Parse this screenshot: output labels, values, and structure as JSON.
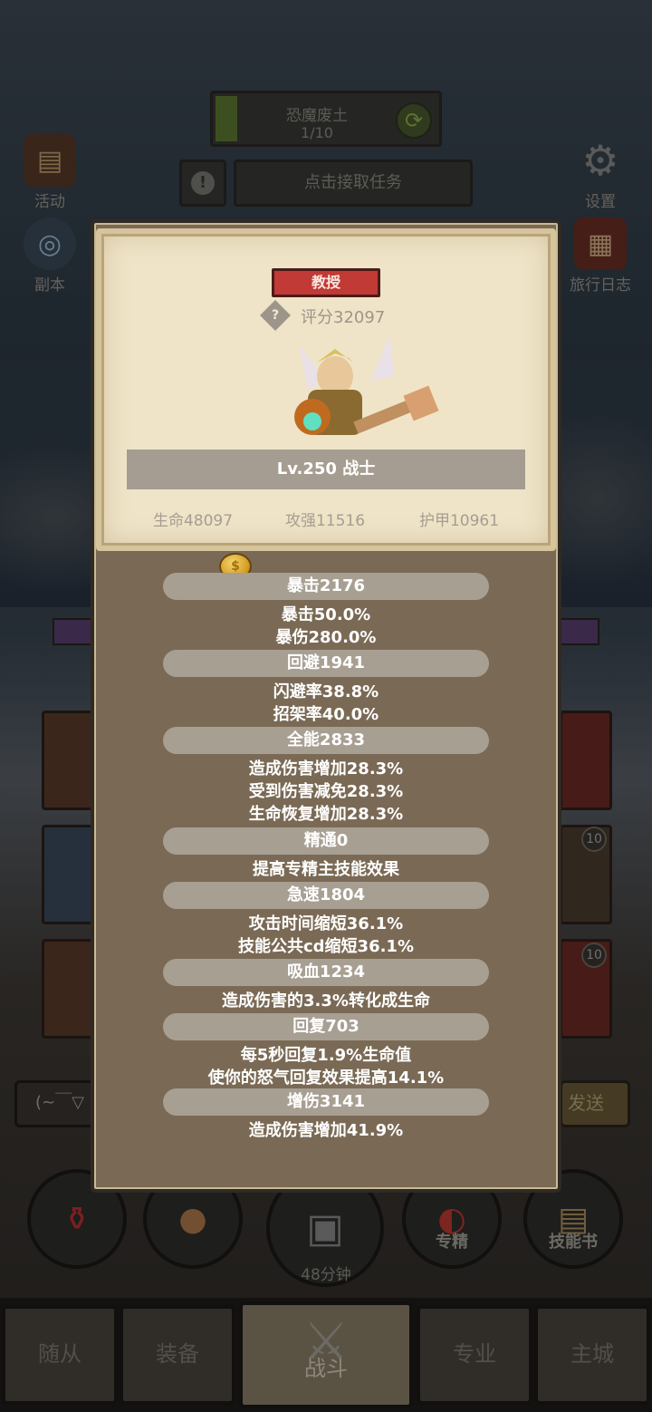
{
  "quest": {
    "name": "恐魔废土",
    "count": "1/10",
    "task_button": "点击接取任务"
  },
  "side_left": [
    {
      "label": "活动",
      "icon": "activity-banner-icon"
    },
    {
      "label": "副本",
      "icon": "dungeon-portal-icon"
    }
  ],
  "side_right": [
    {
      "label": "设置",
      "icon": "gear-icon"
    },
    {
      "label": "旅行日志",
      "icon": "journal-book-icon"
    }
  ],
  "chat": {
    "placeholder_text": "(~￣▽",
    "send_label": "发送"
  },
  "round_buttons": [
    {
      "name": "potion",
      "label": ""
    },
    {
      "name": "food",
      "label": ""
    },
    {
      "name": "chest",
      "label": ""
    },
    {
      "name": "specialization",
      "label": "专精"
    },
    {
      "name": "skill-book",
      "label": "技能书"
    }
  ],
  "chest_timer": "48分钟",
  "nav": {
    "tab1": "随从",
    "tab2": "装备",
    "tab3": "战斗",
    "tab4": "专业",
    "tab5": "主城"
  },
  "badges": {
    "b1": "10",
    "b2": "10"
  },
  "panel": {
    "title_badge": "教授",
    "score_icon": "?",
    "score": "评分32097",
    "level": "Lv.250 战士",
    "hp": "生命48097",
    "attack": "攻强11516",
    "armor": "护甲10961",
    "coin_symbol": "$",
    "stats": [
      {
        "head": "暴击2176",
        "lines": [
          "暴击50.0%",
          "暴伤280.0%"
        ]
      },
      {
        "head": "回避1941",
        "lines": [
          "闪避率38.8%",
          "招架率40.0%"
        ]
      },
      {
        "head": "全能2833",
        "lines": [
          "造成伤害增加28.3%",
          "受到伤害减免28.3%",
          "生命恢复增加28.3%"
        ]
      },
      {
        "head": "精通0",
        "lines": [
          "提高专精主技能效果"
        ]
      },
      {
        "head": "急速1804",
        "lines": [
          "攻击时间缩短36.1%",
          "技能公共cd缩短36.1%"
        ]
      },
      {
        "head": "吸血1234",
        "lines": [
          "造成伤害的3.3%转化成生命"
        ]
      },
      {
        "head": "回复703",
        "lines": [
          "每5秒回复1.9%生命值",
          "使你的怒气回复效果提高14.1%"
        ]
      },
      {
        "head": "增伤3141",
        "lines": [
          "造成伤害增加41.9%"
        ]
      }
    ]
  },
  "colors": {
    "badge_red": "#c13a36",
    "panel_brown": "#7a6a55",
    "parchment": "#efe4c8"
  }
}
